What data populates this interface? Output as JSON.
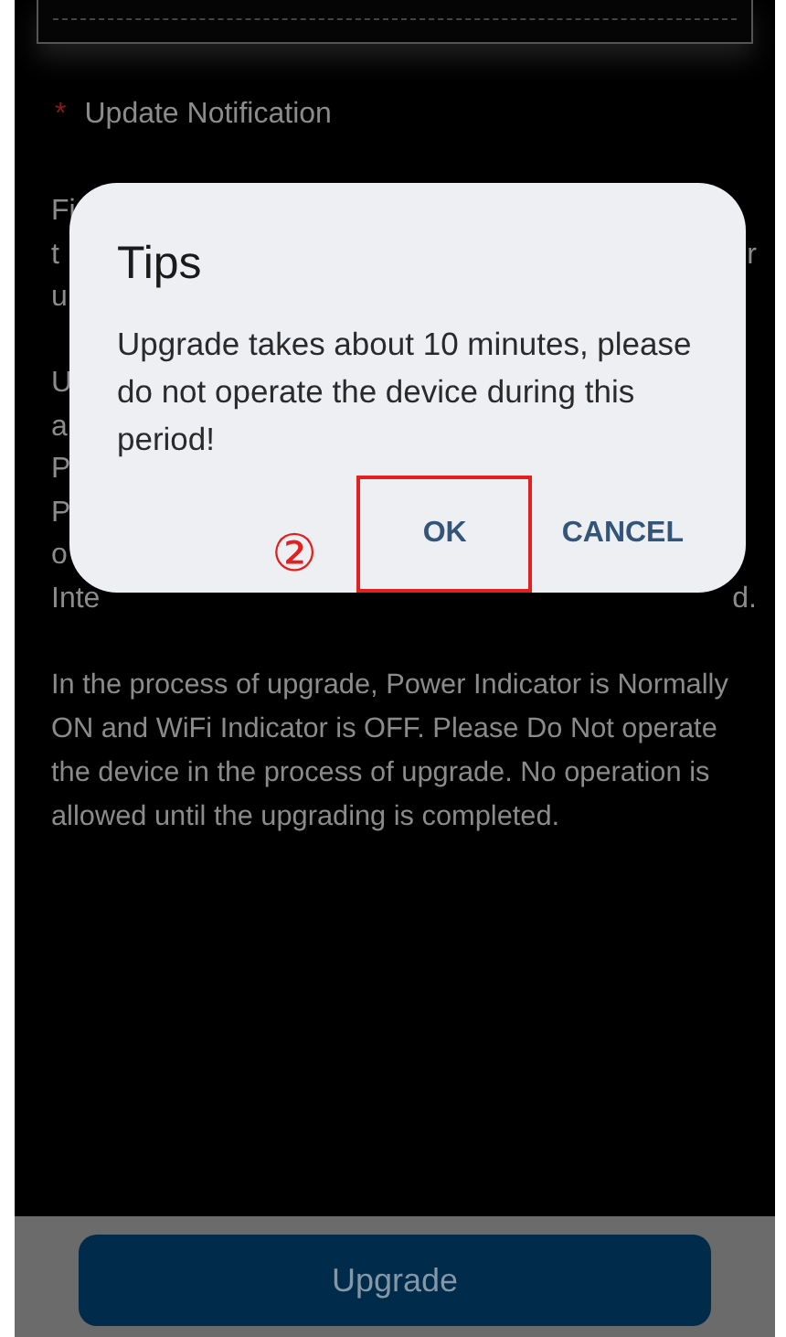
{
  "section_title": {
    "required_mark": "*",
    "label": "Update Notification"
  },
  "covered_lines": [
    {
      "left": "Fi"
    },
    {
      "left": "t",
      "right": "r"
    },
    {
      "left": "u"
    },
    {
      "left": "U",
      "paragraph_start": true
    },
    {
      "left": "a"
    },
    {
      "left": "P"
    },
    {
      "left": "P"
    },
    {
      "left": "o"
    },
    {
      "left": "Inte",
      "right": "d."
    }
  ],
  "notice": "In the process of upgrade, Power Indicator is Normally ON and WiFi Indicator is OFF. Please Do Not operate the device in the process of upgrade. No operation is allowed until the upgrading is completed.",
  "dialog": {
    "title": "Tips",
    "message": "Upgrade takes about 10 minutes, please do not operate the device during this period!",
    "buttons": [
      {
        "label": "OK",
        "highlighted": true
      },
      {
        "label": "CANCEL",
        "highlighted": false
      }
    ],
    "step_marker": "②"
  },
  "upgrade_button": "Upgrade"
}
